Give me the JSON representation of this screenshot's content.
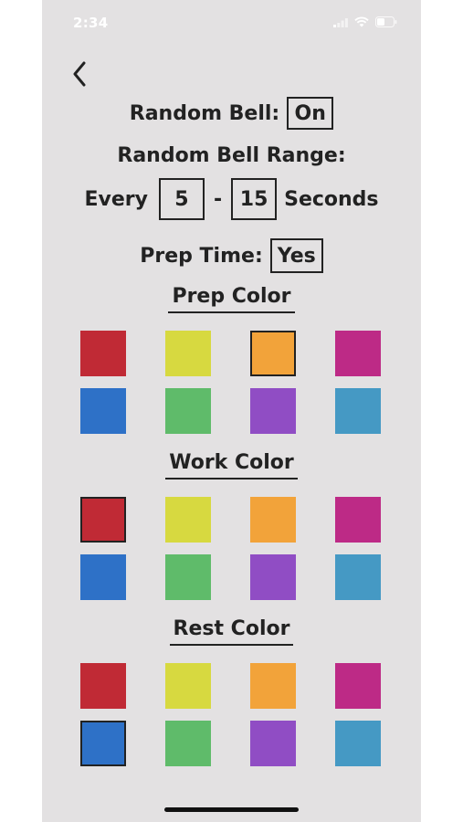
{
  "status_bar": {
    "time": "2:34"
  },
  "random_bell": {
    "label": "Random Bell:",
    "value": "On"
  },
  "range": {
    "title": "Random Bell Range:",
    "prefix": "Every",
    "min": "5",
    "separator": "-",
    "max": "15",
    "suffix": "Seconds"
  },
  "prep_time": {
    "label": "Prep Time:",
    "value": "Yes"
  },
  "palette": [
    {
      "name": "red",
      "hex": "#c02a35"
    },
    {
      "name": "yellow",
      "hex": "#d7d940"
    },
    {
      "name": "orange",
      "hex": "#f2a33a"
    },
    {
      "name": "magenta",
      "hex": "#bd2a86"
    },
    {
      "name": "blue",
      "hex": "#2e71c7"
    },
    {
      "name": "green",
      "hex": "#5fbb6a"
    },
    {
      "name": "purple",
      "hex": "#904dc4"
    },
    {
      "name": "teal",
      "hex": "#4599c4"
    }
  ],
  "sections": {
    "prep": {
      "title": "Prep Color",
      "selected": "orange"
    },
    "work": {
      "title": "Work Color",
      "selected": "red"
    },
    "rest": {
      "title": "Rest Color",
      "selected": "blue"
    }
  }
}
